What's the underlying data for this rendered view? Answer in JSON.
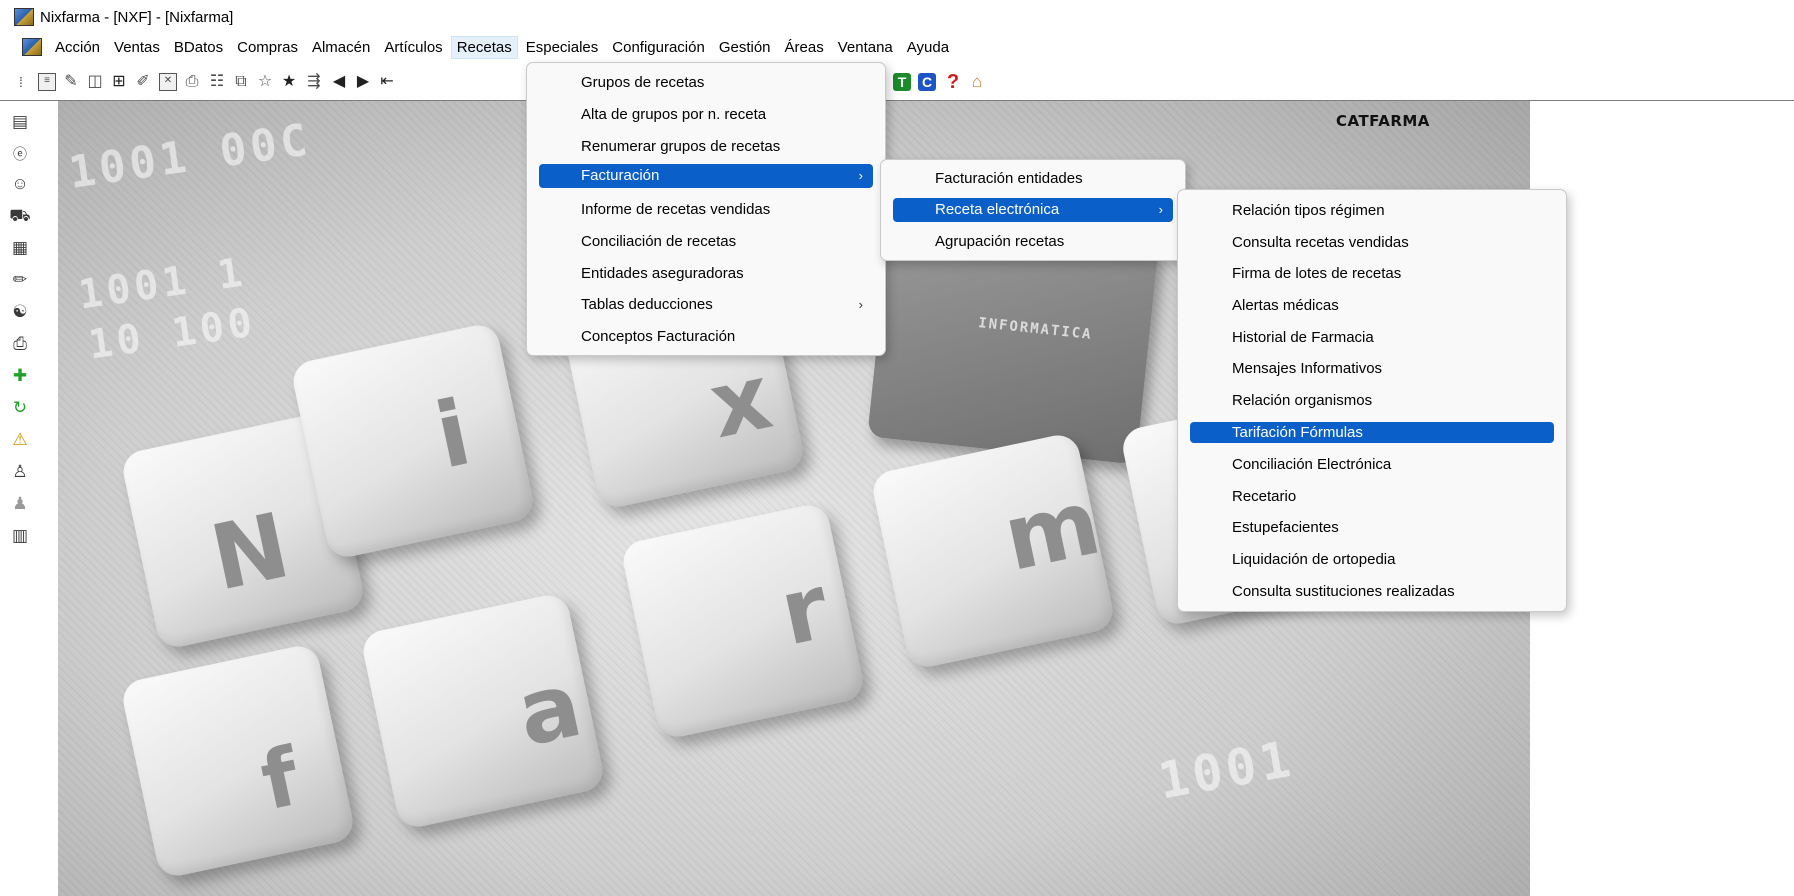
{
  "window": {
    "title": "Nixfarma - [NXF] - [Nixfarma]"
  },
  "menubar": {
    "items": [
      "Acción",
      "Ventas",
      "BDatos",
      "Compras",
      "Almacén",
      "Artículos",
      "Recetas",
      "Especiales",
      "Configuración",
      "Gestión",
      "Áreas",
      "Ventana",
      "Ayuda"
    ],
    "open_item": "Recetas"
  },
  "toolbar": {
    "letter_buttons": [
      "T",
      "C"
    ],
    "help_glyph": "?"
  },
  "brand": {
    "label": "CATFARMA"
  },
  "background_keys": [
    "N",
    "i",
    "x",
    "f",
    "a",
    "r",
    "m"
  ],
  "background_chip_text": "INFORMATICA",
  "menu_recetas": {
    "items": [
      {
        "label": "Grupos de recetas"
      },
      {
        "label": "Alta de grupos por n. receta"
      },
      {
        "label": "Renumerar grupos de recetas"
      },
      {
        "label": "Facturación",
        "submenu": true,
        "highlighted": true
      },
      {
        "label": "Informe de recetas vendidas"
      },
      {
        "label": "Conciliación de recetas"
      },
      {
        "label": "Entidades aseguradoras"
      },
      {
        "label": "Tablas deducciones",
        "submenu": true
      },
      {
        "label": "Conceptos Facturación"
      }
    ]
  },
  "menu_facturacion": {
    "items": [
      {
        "label": "Facturación entidades"
      },
      {
        "label": "Receta electrónica",
        "submenu": true,
        "highlighted": true
      },
      {
        "label": "Agrupación recetas"
      }
    ]
  },
  "menu_receta_electronica": {
    "items": [
      {
        "label": "Relación tipos régimen"
      },
      {
        "label": "Consulta recetas vendidas"
      },
      {
        "label": "Firma de lotes de recetas"
      },
      {
        "label": "Alertas médicas"
      },
      {
        "label": "Historial de Farmacia"
      },
      {
        "label": "Mensajes Informativos"
      },
      {
        "label": "Relación organismos"
      },
      {
        "label": "Tarifación Fórmulas",
        "highlighted": true
      },
      {
        "label": "Conciliación Electrónica"
      },
      {
        "label": "Recetario"
      },
      {
        "label": "Estupefacientes"
      },
      {
        "label": "Liquidación de ortopedia"
      },
      {
        "label": "Consulta sustituciones realizadas"
      }
    ]
  },
  "colors": {
    "highlight": "#0b5fc9",
    "t_button": "#1a8a2a",
    "c_button": "#1c55c8"
  }
}
